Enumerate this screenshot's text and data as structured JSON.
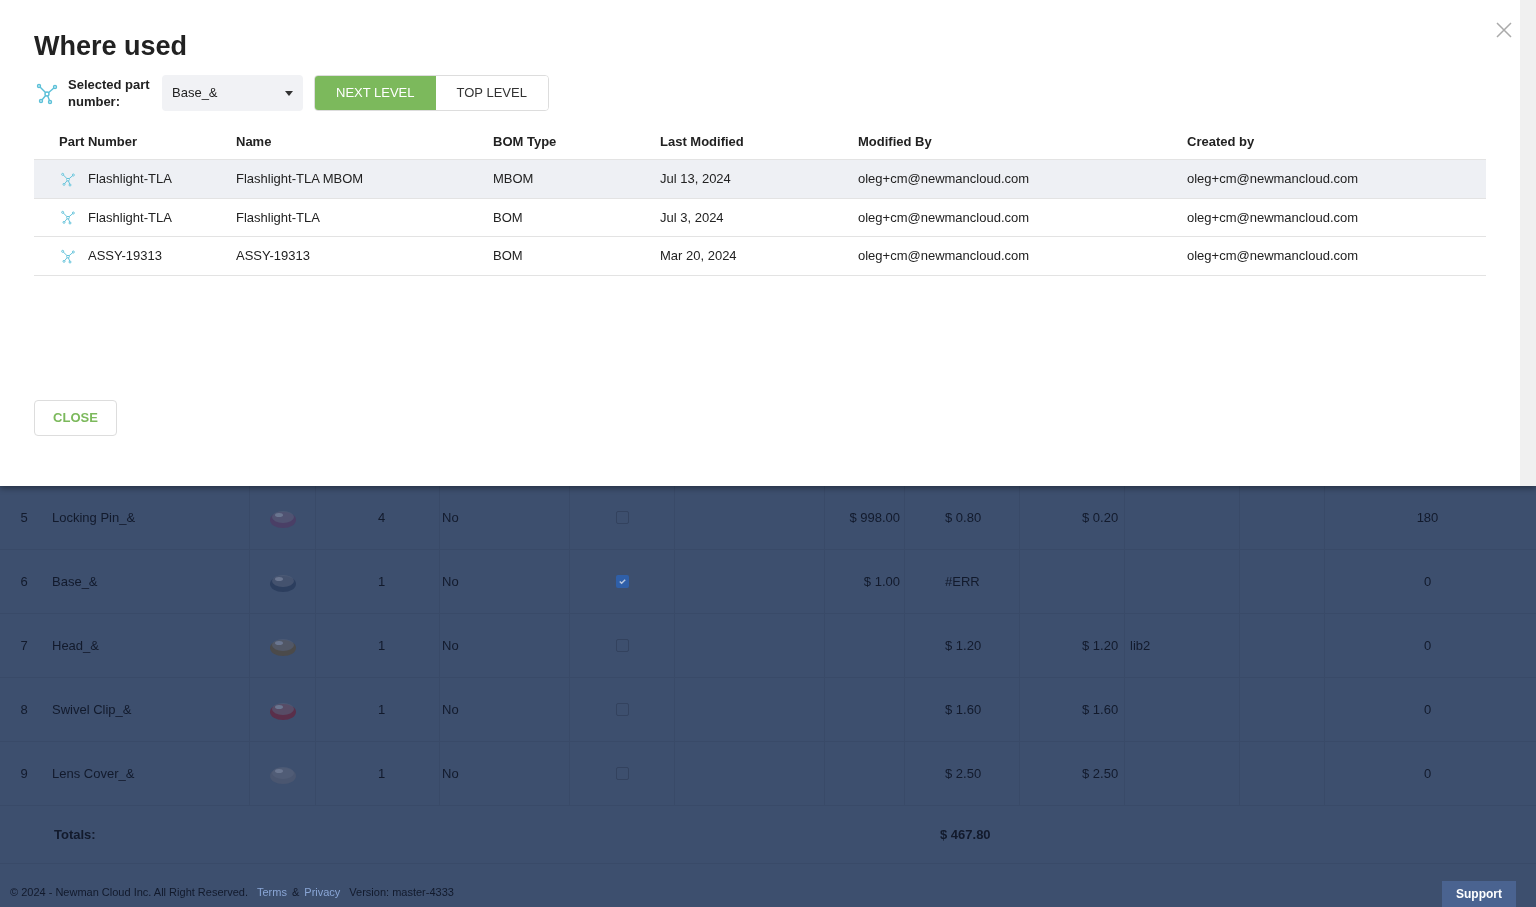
{
  "modal": {
    "title": "Where used",
    "selector": {
      "label": "Selected part number:",
      "value": "Base_&"
    },
    "level_toggle": [
      {
        "label": "NEXT LEVEL",
        "selected": true
      },
      {
        "label": "TOP LEVEL",
        "selected": false
      }
    ],
    "columns": [
      "Part Number",
      "Name",
      "BOM Type",
      "Last Modified",
      "Modified By",
      "Created by"
    ],
    "rows": [
      {
        "part_number": "Flashlight-TLA",
        "name": "Flashlight-TLA MBOM",
        "bom_type": "MBOM",
        "last_modified": "Jul 13, 2024",
        "modified_by": "oleg+cm@newmancloud.com",
        "created_by": "oleg+cm@newmancloud.com",
        "selected": true
      },
      {
        "part_number": "Flashlight-TLA",
        "name": "Flashlight-TLA",
        "bom_type": "BOM",
        "last_modified": "Jul 3, 2024",
        "modified_by": "oleg+cm@newmancloud.com",
        "created_by": "oleg+cm@newmancloud.com",
        "selected": false
      },
      {
        "part_number": "ASSY-19313",
        "name": "ASSY-19313",
        "bom_type": "BOM",
        "last_modified": "Mar 20, 2024",
        "modified_by": "oleg+cm@newmancloud.com",
        "created_by": "oleg+cm@newmancloud.com",
        "selected": false
      }
    ],
    "close_button": "CLOSE"
  },
  "background": {
    "rows": [
      {
        "index": "5",
        "name": "Locking Pin_&",
        "quantity": "4",
        "column_5": "No",
        "checked": false,
        "column_7": "$ 998.00",
        "column_8": "$ 0.80",
        "column_9": "$ 0.20",
        "column_11": "180"
      },
      {
        "index": "6",
        "name": "Base_&",
        "quantity": "1",
        "column_5": "No",
        "checked": true,
        "column_7": "$ 1.00",
        "column_8": "#ERR",
        "column_11": "0"
      },
      {
        "index": "7",
        "name": "Head_&",
        "quantity": "1",
        "column_5": "No",
        "checked": false,
        "column_8": "$ 1.20",
        "column_9": "$ 1.20",
        "column_10": "lib2",
        "column_11": "0"
      },
      {
        "index": "8",
        "name": "Swivel Clip_&",
        "quantity": "1",
        "column_5": "No",
        "checked": false,
        "column_8": "$ 1.60",
        "column_9": "$ 1.60",
        "column_11": "0"
      },
      {
        "index": "9",
        "name": "Lens Cover_&",
        "quantity": "1",
        "column_5": "No",
        "checked": false,
        "column_8": "$ 2.50",
        "column_9": "$ 2.50",
        "column_11": "0"
      }
    ],
    "totals": {
      "label": "Totals:",
      "value": "$ 467.80"
    },
    "footer": {
      "copyright": "© 2024 - Newman Cloud Inc. All Right Reserved.",
      "terms_link": "Terms",
      "separator": "&",
      "privacy_link": "Privacy",
      "version": "Version: master-4333"
    },
    "support_button": "Support"
  }
}
